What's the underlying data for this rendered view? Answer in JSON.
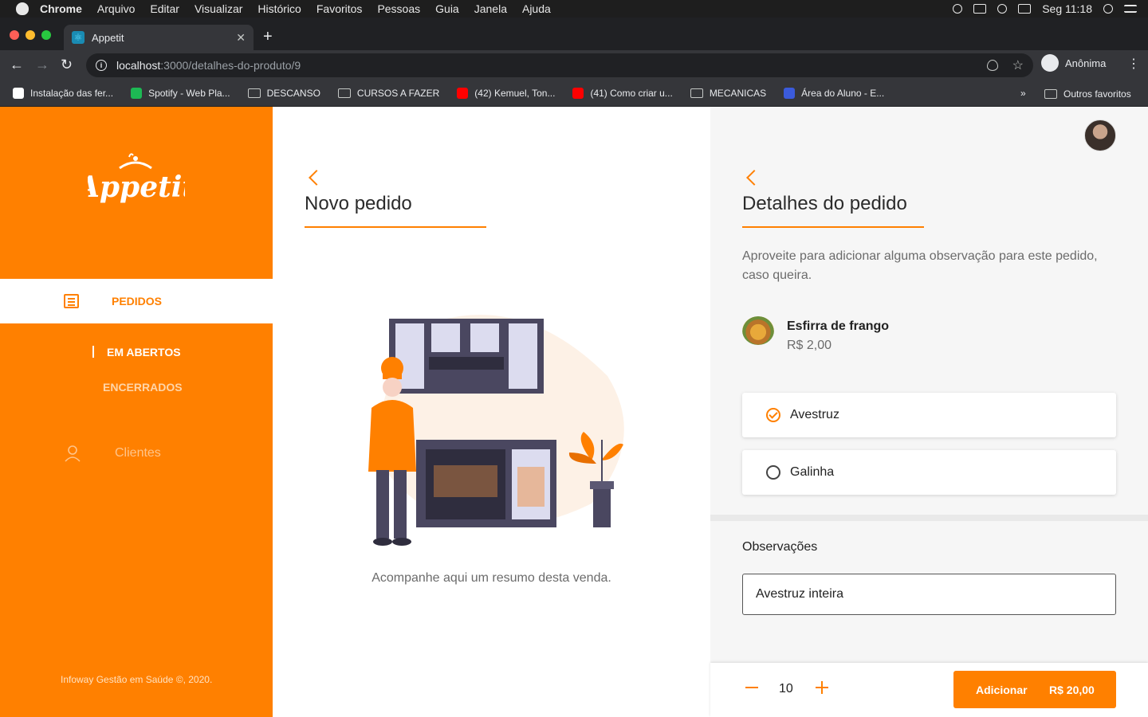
{
  "menubar": {
    "app": "Chrome",
    "items": [
      "Arquivo",
      "Editar",
      "Visualizar",
      "Histórico",
      "Favoritos",
      "Pessoas",
      "Guia",
      "Janela",
      "Ajuda"
    ],
    "clock": "Seg 11:18"
  },
  "browser": {
    "tab_title": "Appetit",
    "url_host": "localhost",
    "url_path": ":3000/detalhes-do-produto/9",
    "profile": "Anônima",
    "bookmarks": [
      {
        "label": "Instalação das fer...",
        "icon": "notion-icon",
        "color": "#ffffff"
      },
      {
        "label": "Spotify - Web Pla...",
        "icon": "spotify-icon",
        "color": "#1db954"
      },
      {
        "label": "DESCANSO",
        "icon": "folder-icon"
      },
      {
        "label": "CURSOS A FAZER",
        "icon": "folder-icon"
      },
      {
        "label": "(42) Kemuel, Ton...",
        "icon": "youtube-icon",
        "color": "#ff0000"
      },
      {
        "label": "(41) Como criar u...",
        "icon": "youtube-icon",
        "color": "#ff0000"
      },
      {
        "label": "MECANICAS",
        "icon": "folder-icon"
      },
      {
        "label": "Área do Aluno - E...",
        "icon": "shield-icon",
        "color": "#3b5bdb"
      }
    ],
    "bookmarks_more": "»",
    "other_bookmarks": "Outros favoritos"
  },
  "sidebar": {
    "logo_text": "Appetit",
    "pedidos_label": "PEDIDOS",
    "sub_active": "EM ABERTOS",
    "sub_inactive": "ENCERRADOS",
    "clientes_label": "Clientes",
    "footer": "Infoway Gestão em Saúde ©, 2020."
  },
  "middle": {
    "title": "Novo pedido",
    "caption": "Acompanhe aqui um resumo desta venda."
  },
  "details": {
    "title": "Detalhes do pedido",
    "hint": "Aproveite para adicionar alguma observação para este pedido, caso queira.",
    "product_name": "Esfirra de frango",
    "product_price": "R$ 2,00",
    "options": [
      {
        "label": "Avestruz",
        "selected": true
      },
      {
        "label": "Galinha",
        "selected": false
      }
    ],
    "obs_label": "Observações",
    "obs_value": "Avestruz inteira",
    "quantity": "10",
    "add_label": "Adicionar",
    "add_total": "R$ 20,00"
  },
  "colors": {
    "accent": "#ff8000",
    "panel_bg": "#f6f6f6"
  }
}
